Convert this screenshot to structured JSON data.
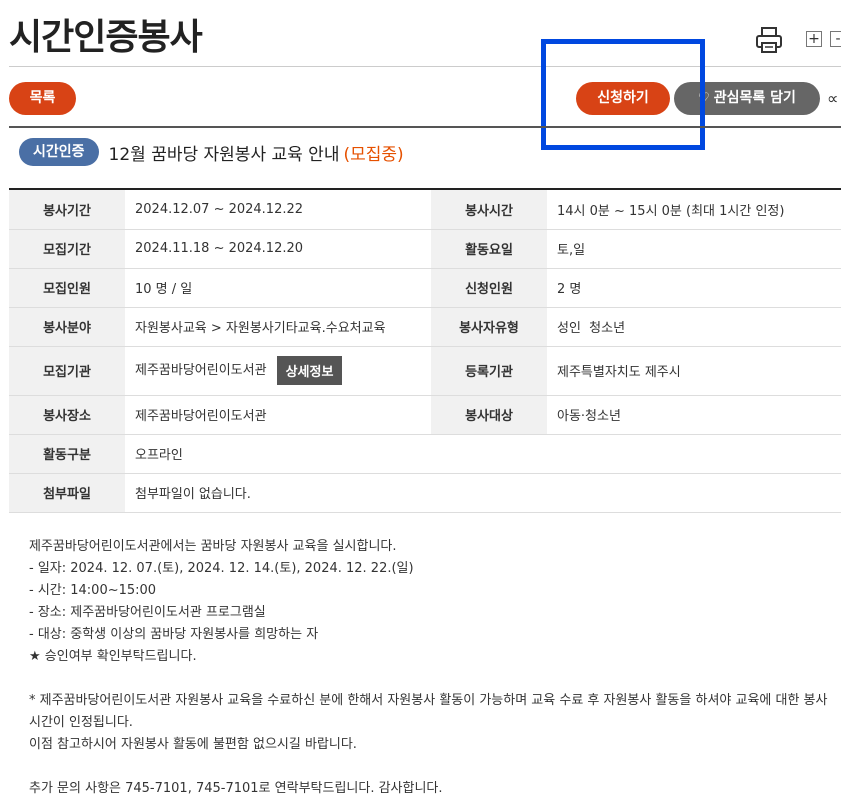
{
  "page": {
    "title": "시간인증봉사",
    "zoom_in": "+",
    "zoom_out": "-"
  },
  "actions": {
    "list_label": "목록",
    "apply_label": "신청하기",
    "favorite_label": "관심목록 담기",
    "share_icon": "share-icon"
  },
  "heading": {
    "badge": "시간인증",
    "title": "12월 꿈바당 자원봉사 교육 안내",
    "status": "(모집중)"
  },
  "info": {
    "period_label": "봉사기간",
    "period_value": "2024.12.07 ~ 2024.12.22",
    "time_label": "봉사시간",
    "time_value": "14시 0분 ~ 15시 0분 (최대 1시간 인정)",
    "recruit_period_label": "모집기간",
    "recruit_period_value": "2024.11.18 ~ 2024.12.20",
    "days_label": "활동요일",
    "days_value": "토,일",
    "recruit_count_label": "모집인원",
    "recruit_count_value": "10 명 / 일",
    "applicants_label": "신청인원",
    "applicants_value": "2 명",
    "field_label": "봉사분야",
    "field_value": "자원봉사교육 > 자원봉사기타교육.수요처교육",
    "volunteer_type_label": "봉사자유형",
    "volunteer_type_value": "성인  청소년",
    "org_label": "모집기관",
    "org_value": "제주꿈바당어린이도서관",
    "org_detail_button": "상세정보",
    "reg_org_label": "등록기관",
    "reg_org_value": "제주특별자치도 제주시",
    "place_label": "봉사장소",
    "place_value": "제주꿈바당어린이도서관",
    "target_label": "봉사대상",
    "target_value": "아동·청소년",
    "activity_label": "활동구분",
    "activity_value": "오프라인",
    "attachment_label": "첨부파일",
    "attachment_value": "첨부파일이 없습니다."
  },
  "description": {
    "line1": "제주꿈바당어린이도서관에서는 꿈바당 자원봉사 교육을 실시합니다.",
    "line2": "- 일자: 2024. 12. 07.(토), 2024. 12. 14.(토), 2024. 12. 22.(일)",
    "line3": "- 시간: 14:00~15:00",
    "line4": "- 장소: 제주꿈바당어린이도서관 프로그램실",
    "line5": "- 대상: 중학생 이상의 꿈바당 자원봉사를 희망하는 자",
    "line6": "★ 승인여부 확인부탁드립니다.",
    "line7": "* 제주꿈바당어린이도서관 자원봉사 교육을 수료하신 분에 한해서 자원봉사 활동이 가능하며 교육 수료 후 자원봉사 활동을 하셔야 교육에 대한 봉사시간이 인정됩니다.",
    "line8": "이점 참고하시어 자원봉사 활동에 불편함 없으시길 바랍니다.",
    "line9": "추가 문의 사항은 745-7101, 745-7101로 연락부탁드립니다. 감사합니다."
  },
  "colors": {
    "accent": "#d84315",
    "status": "#e65100",
    "badge": "#4a6fa5",
    "highlight": "#0048e0"
  }
}
